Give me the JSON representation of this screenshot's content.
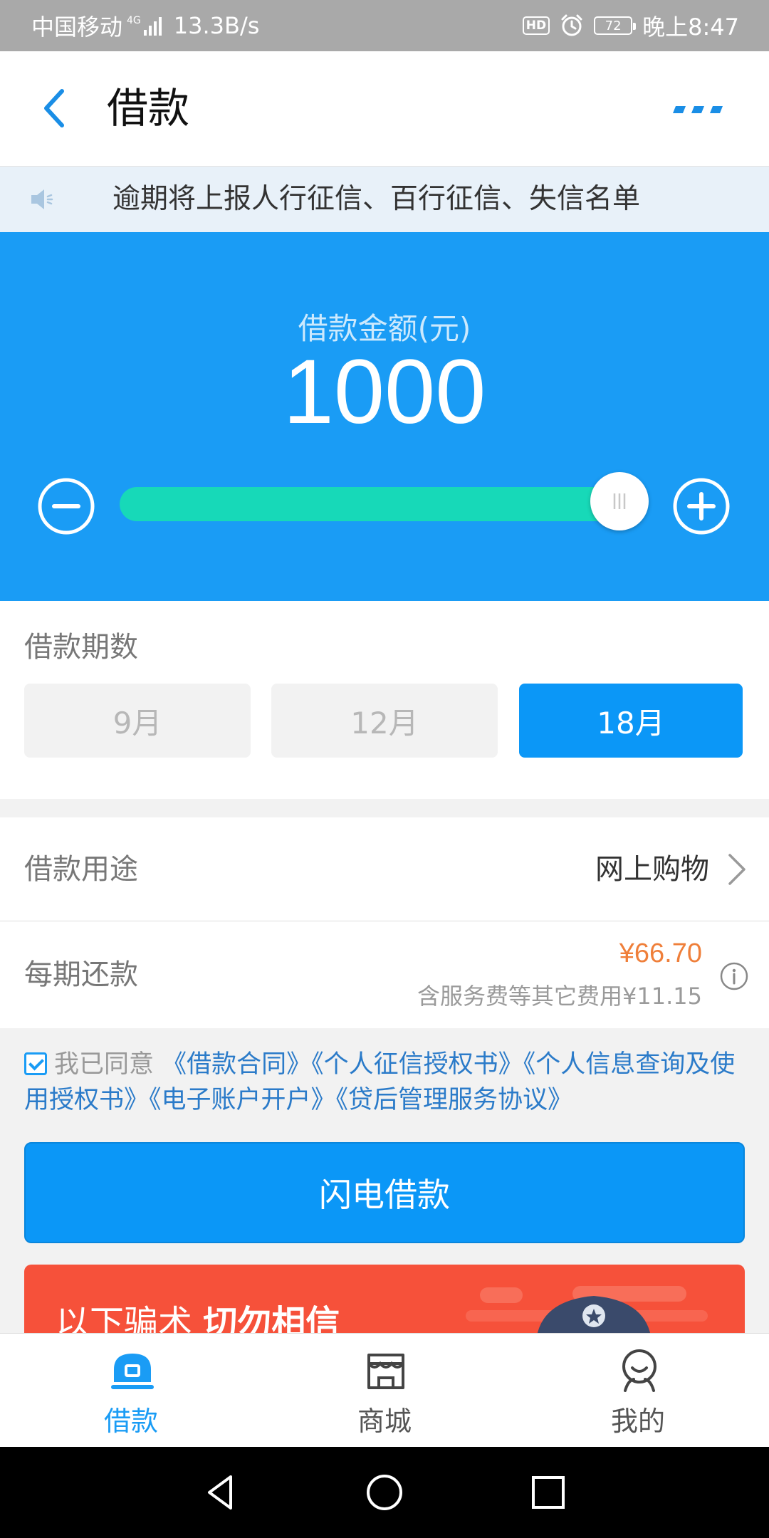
{
  "status_bar": {
    "carrier": "中国移动",
    "network": "4G",
    "speed": "13.3B/s",
    "hd": "HD",
    "battery": "72",
    "time": "晚上8:47"
  },
  "header": {
    "title": "借款",
    "back_icon": "chevron-left-icon",
    "more_icon": "more-dots-icon"
  },
  "notice": {
    "icon": "speaker-icon",
    "text": "逾期将上报人行征信、百行征信、失信名单"
  },
  "amount": {
    "label": "借款金额(元)",
    "value": "1000",
    "slider_fraction": 1.0
  },
  "term": {
    "label": "借款期数",
    "options": [
      {
        "label": "9月",
        "selected": false
      },
      {
        "label": "12月",
        "selected": false
      },
      {
        "label": "18月",
        "selected": true
      }
    ]
  },
  "purpose": {
    "label": "借款用途",
    "value": "网上购物"
  },
  "repayment": {
    "label": "每期还款",
    "amount": "¥66.70",
    "note": "含服务费等其它费用¥11.15"
  },
  "agreement": {
    "checked": true,
    "prefix": "我已同意",
    "docs": [
      "《借款合同》",
      "《个人征信授权书》",
      "《个人信息查询及使用授权书》",
      "《电子账户开户》",
      "《贷后管理服务协议》"
    ]
  },
  "submit": {
    "label": "闪电借款"
  },
  "warning_banner": {
    "text_normal": "以下骗术 ",
    "text_bold": "切勿相信"
  },
  "bottom_nav": {
    "items": [
      {
        "label": "借款",
        "icon": "loan-icon",
        "active": true
      },
      {
        "label": "商城",
        "icon": "store-icon",
        "active": false
      },
      {
        "label": "我的",
        "icon": "profile-icon",
        "active": false
      }
    ]
  },
  "colors": {
    "primary": "#1a9cf5",
    "slider": "#17d9b8",
    "price": "#ef7f3a",
    "warning": "#f6513a"
  }
}
